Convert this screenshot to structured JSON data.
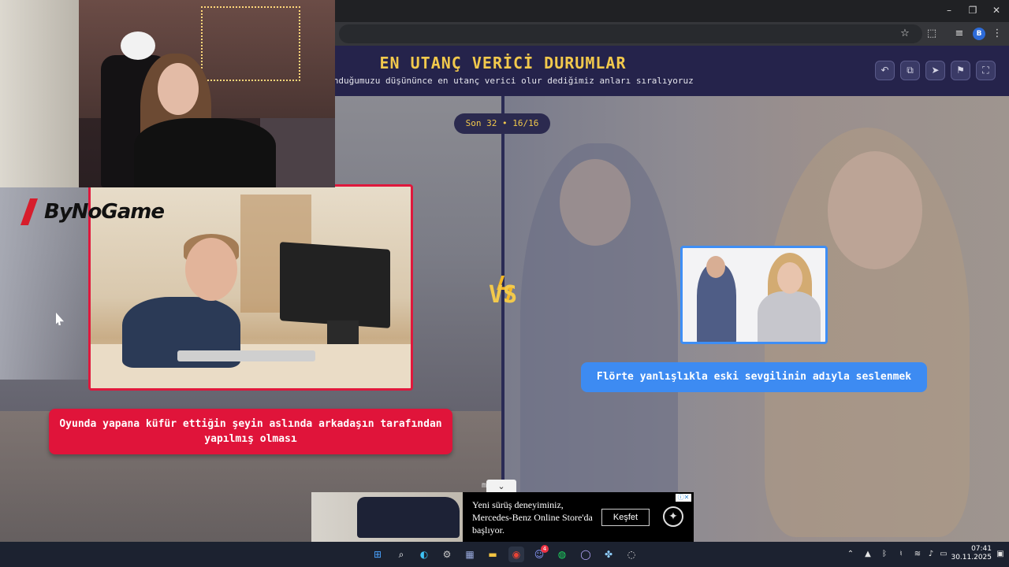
{
  "game": {
    "title": "EN UTANÇ VERİCİ DURUMLAR",
    "subtitle": "bulunduğumuzu düşününce en utanç verici olur dediğimiz anları sıralıyoruz",
    "round_label": "Son 32 • 16/16",
    "vs_label": "VS",
    "left_option": "Oyunda yapana küfür ettiğin şeyin aslında arkadaşın tarafından yapılmış olması",
    "right_option": "Flörte yanlışlıkla eski sevgilinin adıyla seslenmek",
    "header_buttons": [
      "undo-icon",
      "share-icon",
      "send-icon",
      "flag-icon",
      "fullscreen-icon"
    ],
    "peek_text": "m    h"
  },
  "overlay": {
    "logo_text": "ByNoGame"
  },
  "ad": {
    "text": "Yeni sürüş deneyiminiz, Mercedes-Benz Online Store'da başlıyor.",
    "button": "Keşfet"
  },
  "taskbar": {
    "time": "07:41",
    "date": "30.11.2025",
    "discord_badge": "4"
  },
  "browser": {
    "profile_initial": "B"
  },
  "colors": {
    "header_bg": "#25234b",
    "title_yellow": "#f2c94c",
    "left_red": "#e0143a",
    "right_blue": "#3d8bf2"
  }
}
